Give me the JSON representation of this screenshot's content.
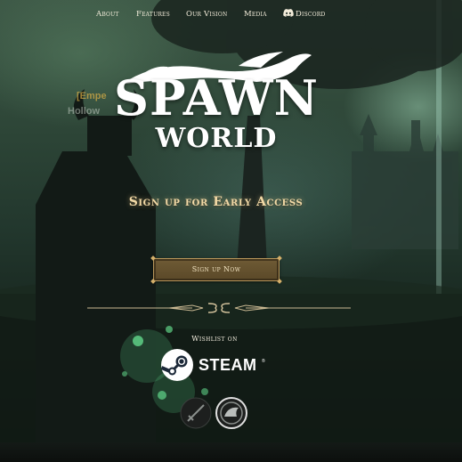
{
  "nav": {
    "items": [
      {
        "label": "About"
      },
      {
        "label": "Features"
      },
      {
        "label": "Our Vision"
      },
      {
        "label": "Media"
      },
      {
        "label": "Discord",
        "icon": "discord-icon"
      }
    ]
  },
  "background": {
    "player_name": "[Empe",
    "player_guild": "Hollow"
  },
  "logo": {
    "line1": "SPAWN",
    "line2": "WORLD"
  },
  "signup": {
    "heading": "Sign up for Early Access",
    "button_label": "Sign up Now"
  },
  "wishlist": {
    "label": "Wishlist on",
    "steam_small": "",
    "steam_text": "STEAM",
    "steam_reg": "®"
  },
  "badges": [
    {
      "icon": "sword-badge-icon"
    },
    {
      "icon": "helmet-badge-icon"
    }
  ],
  "colors": {
    "accent_gold": "#b8965a",
    "button_fill": "#6f5b35",
    "heading_gold": "#f2d9a6"
  }
}
